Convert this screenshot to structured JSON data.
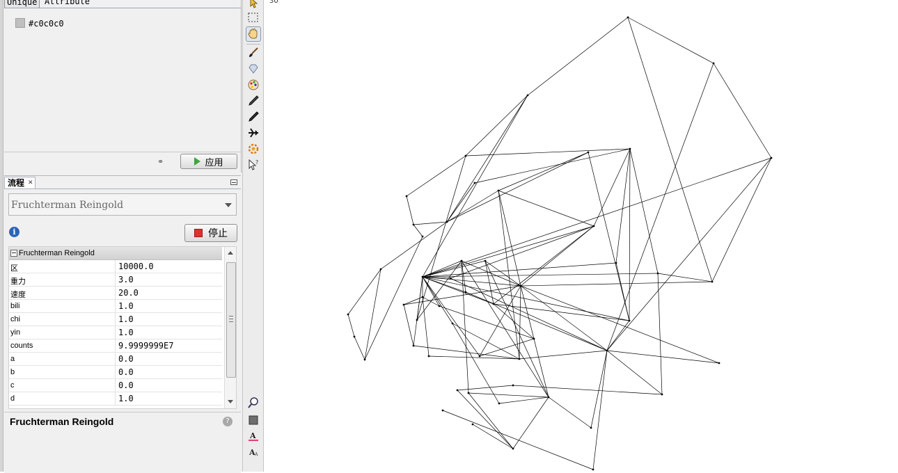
{
  "partition": {
    "tabs": [
      "Unique",
      "Attribute"
    ],
    "value_color": "#c0c0c0",
    "value_label": "#c0c0c0",
    "apply_label": "应用"
  },
  "layout": {
    "tab_label": "流程",
    "algorithm_selected": "Fruchterman Reingold",
    "stop_label": "停止",
    "section_title": "Fruchterman Reingold",
    "properties": [
      {
        "name": "区",
        "value": "10000.0"
      },
      {
        "name": "重力",
        "value": "3.0"
      },
      {
        "name": "速度",
        "value": "20.0"
      },
      {
        "name": "bili",
        "value": "1.0"
      },
      {
        "name": "chi",
        "value": "1.0"
      },
      {
        "name": "yin",
        "value": "1.0"
      },
      {
        "name": "counts",
        "value": "9.9999999E7"
      },
      {
        "name": "a",
        "value": "0.0"
      },
      {
        "name": "b",
        "value": "0.0"
      },
      {
        "name": "c",
        "value": "0.0"
      },
      {
        "name": "d",
        "value": "1.0"
      }
    ],
    "description_title": "Fruchterman Reingold"
  },
  "toolbar": {
    "tools": [
      "cursor-icon",
      "rectangle-select-icon",
      "drag-hand-icon",
      "brush-icon",
      "diamond-icon",
      "painter-palette-icon",
      "pencil-icon",
      "edge-pencil-icon",
      "airplane-icon",
      "heatmap-icon",
      "shortest-path-icon"
    ],
    "bottom_tools": [
      "zoom-fit-icon",
      "background-color-icon",
      "font-color-icon",
      "font-size-icon"
    ]
  },
  "graph": {
    "corner_label": "30",
    "edge_color": "#000000",
    "background": "#ffffff"
  }
}
